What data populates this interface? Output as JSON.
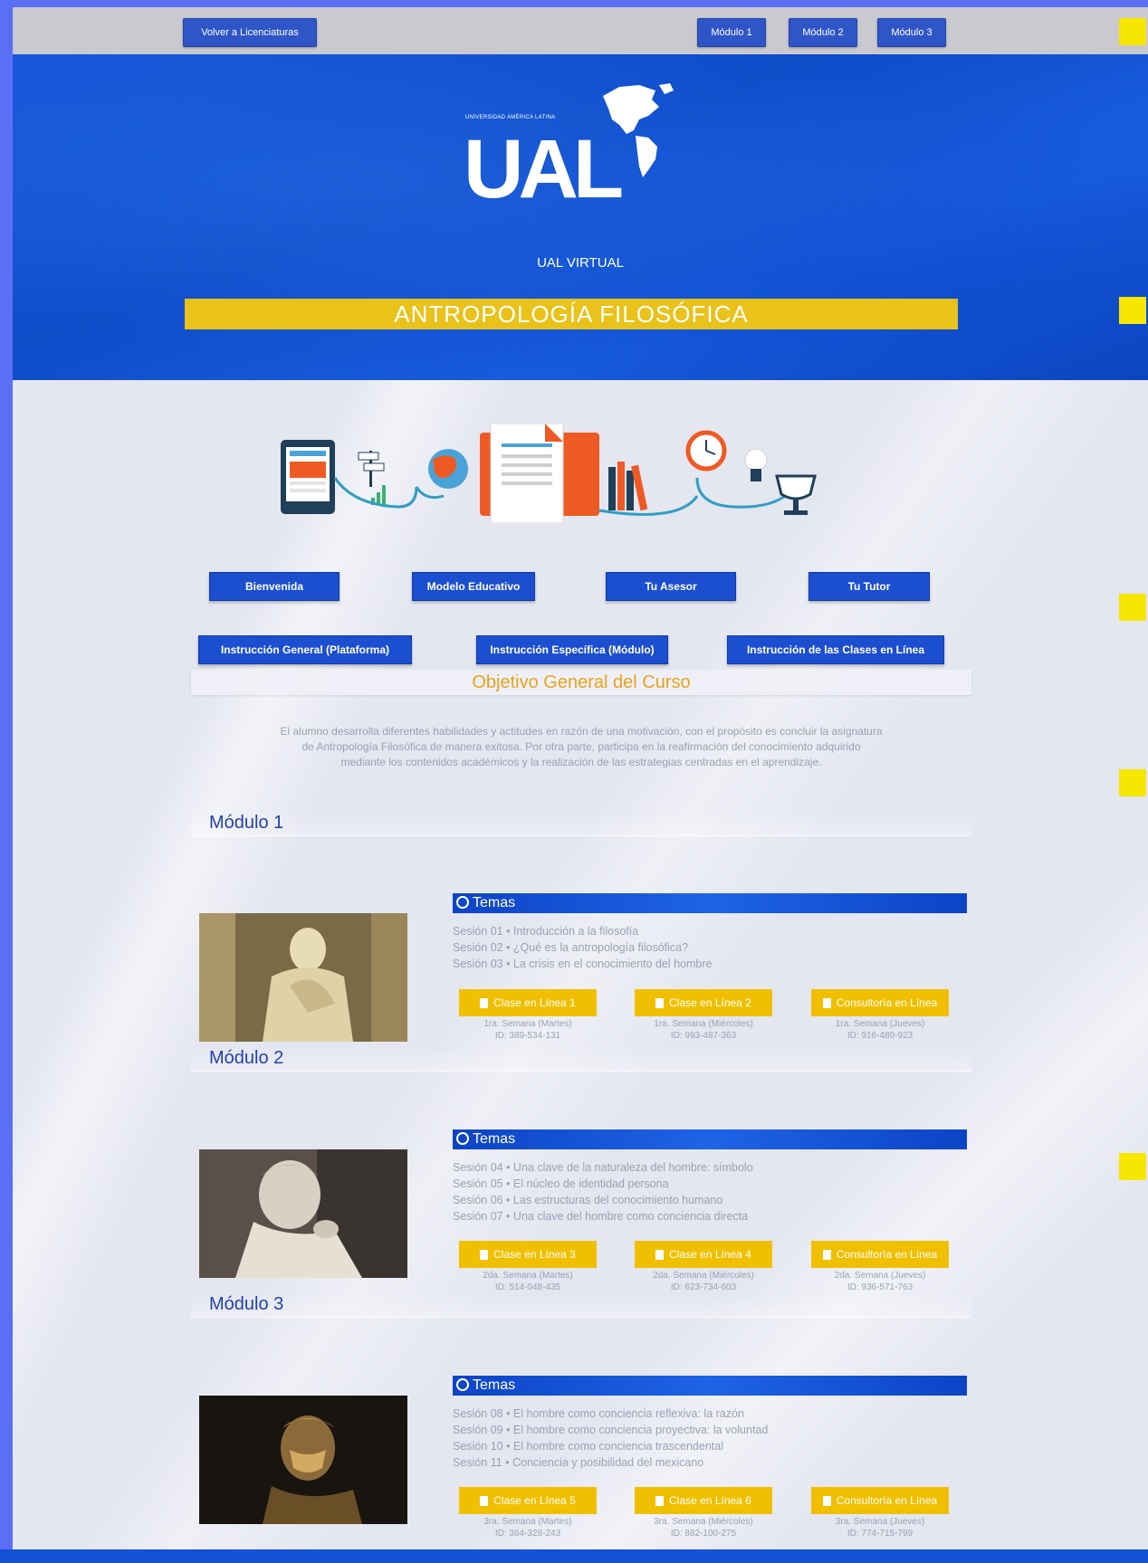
{
  "navbar": {
    "back": "Volver a Licenciaturas",
    "modules": [
      "Módulo 1",
      "Módulo 2",
      "Módulo 3"
    ]
  },
  "header": {
    "logo_small": "UNIVERSIDAD AMÉRICA LATINA",
    "logo_text": "UAL",
    "subtitle": "UAL VIRTUAL",
    "course_title": "ANTROPOLOGÍA FILOSÓFICA"
  },
  "buttons_row1": [
    "Bienvenida",
    "Modelo Educativo",
    "Tu Asesor",
    "Tu Tutor"
  ],
  "buttons_row2": [
    "Instrucción General (Plataforma)",
    "Instrucción Específica (Módulo)",
    "Instrucción de las Clases en Línea"
  ],
  "objective": {
    "title": "Objetivo General del Curso",
    "lines": [
      "El alumno desarrolla diferentes habilidades y actitudes en razón de una motivación, con el propósito es concluir la asignatura",
      "de Antropología Filosófica de manera exitosa. Por otra parte, participa en la reafirmación del conocimiento adquirido",
      "mediante los contenidos académicos y la realización de las estrategias centradas en el aprendizaje."
    ]
  },
  "temas_label": "Temas",
  "modules": [
    {
      "title": "Módulo 1",
      "sessions": [
        "Sesión 01 • Introducción a la filosofía",
        "Sesión 02 • ¿Qué es la antropología filosófica?",
        "Sesión 03 • La crisis en el conocimiento del hombre"
      ],
      "actions": [
        {
          "label": "Clase en Línea 1",
          "week": "1ra. Semana (Martes)",
          "id": "ID: 389-534-131"
        },
        {
          "label": "Clase en Línea 2",
          "week": "1ra. Semana (Miércoles)",
          "id": "ID: 993-487-363"
        },
        {
          "label": "Consultoría en Línea",
          "week": "1ra. Semana (Jueves)",
          "id": "ID: 916-480-923"
        }
      ]
    },
    {
      "title": "Módulo 2",
      "sessions": [
        "Sesión 04 • Una clave de la naturaleza del hombre: símbolo",
        "Sesión 05 • El núcleo de identidad persona",
        "Sesión 06 • Las estructuras del conocimiento humano",
        "Sesión 07 • Una clave del hombre como conciencia directa"
      ],
      "actions": [
        {
          "label": "Clase en Línea 3",
          "week": "2da. Semana (Martes)",
          "id": "ID: 514-048-435"
        },
        {
          "label": "Clase en Línea 4",
          "week": "2da. Semana (Miércoles)",
          "id": "ID: 623-734-603"
        },
        {
          "label": "Consultoría en Línea",
          "week": "2da. Semana (Jueves)",
          "id": "ID: 936-571-763"
        }
      ]
    },
    {
      "title": "Módulo 3",
      "sessions": [
        "Sesión 08 • El hombre como conciencia reflexiva: la razón",
        "Sesión 09 • El hombre como conciencia proyectiva: la voluntad",
        "Sesión 10 • El hombre como conciencia trascendental",
        "Sesión 11 • Conciencia y posibilidad del mexicano"
      ],
      "actions": [
        {
          "label": "Clase en Línea 5",
          "week": "3ra. Semana (Martes)",
          "id": "ID: 364-328-243"
        },
        {
          "label": "Clase en Línea 6",
          "week": "3ra. Semana (Miércoles)",
          "id": "ID: 882-100-275"
        },
        {
          "label": "Consultoría en Línea",
          "week": "3ra. Semana (Jueves)",
          "id": "ID: 774-715-799"
        }
      ]
    }
  ]
}
